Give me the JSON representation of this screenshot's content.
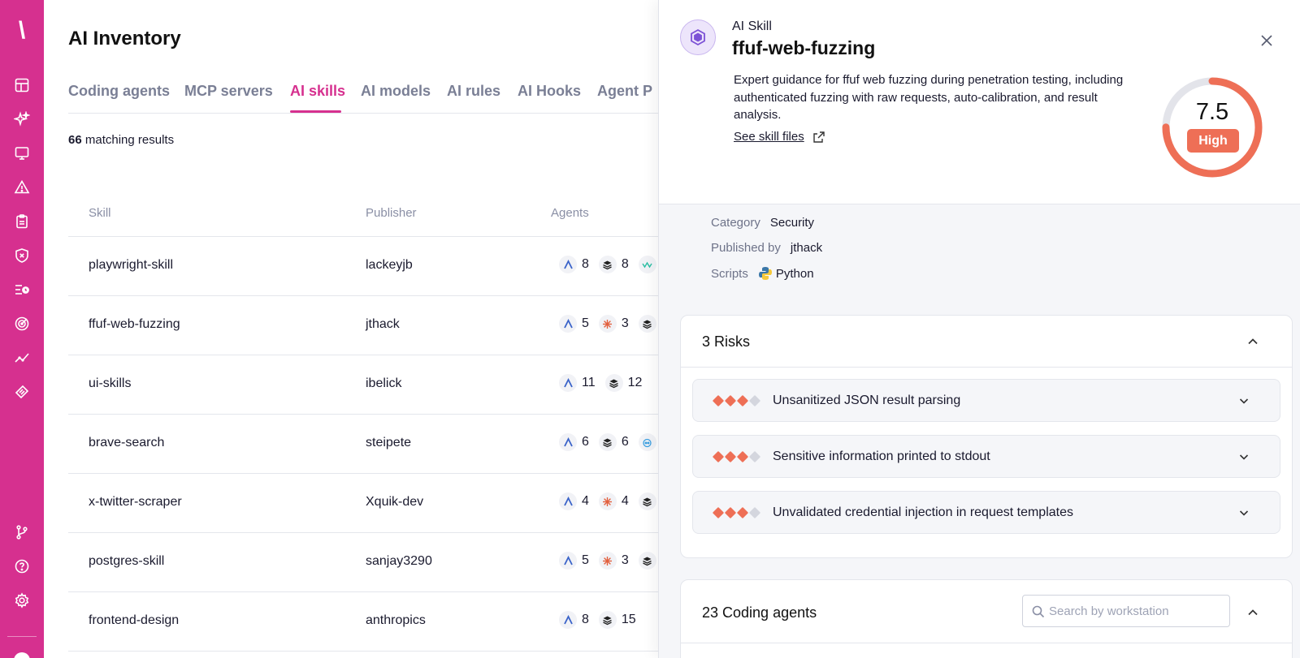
{
  "sidebar": {
    "logo_glyph": "\\",
    "items": [
      {
        "name": "dashboard-icon"
      },
      {
        "name": "sparkles-icon"
      },
      {
        "name": "monitor-icon"
      },
      {
        "name": "alert-triangle-icon"
      },
      {
        "name": "clipboard-icon"
      },
      {
        "name": "shield-x-icon"
      },
      {
        "name": "list-clock-icon"
      },
      {
        "name": "radar-icon"
      },
      {
        "name": "trend-chart-icon"
      },
      {
        "name": "ticket-icon"
      }
    ],
    "bottom_items": [
      {
        "name": "git-branch-icon"
      },
      {
        "name": "help-icon"
      },
      {
        "name": "settings-icon"
      }
    ],
    "color": "#d6308f"
  },
  "main": {
    "title": "AI Inventory",
    "tabs": [
      {
        "label": "Coding agents"
      },
      {
        "label": "MCP servers"
      },
      {
        "label": "AI skills",
        "active": true
      },
      {
        "label": "AI models"
      },
      {
        "label": "AI rules"
      },
      {
        "label": "AI Hooks"
      },
      {
        "label": "Agent P"
      }
    ],
    "results_count": "66",
    "results_label": " matching results",
    "columns": {
      "skill": "Skill",
      "publisher": "Publisher",
      "agents": "Agents"
    },
    "rows": [
      {
        "skill": "playwright-skill",
        "publisher": "lackeyjb",
        "agents": [
          {
            "icon": "cursor-agent-icon",
            "count": "8"
          },
          {
            "icon": "stack-agent-icon",
            "count": "8"
          },
          {
            "icon": "wave-agent-icon",
            "count": ""
          }
        ]
      },
      {
        "skill": "ffuf-web-fuzzing",
        "publisher": "jthack",
        "agents": [
          {
            "icon": "cursor-agent-icon",
            "count": "5"
          },
          {
            "icon": "claude-agent-icon",
            "count": "3"
          },
          {
            "icon": "stack-agent-icon",
            "count": ""
          }
        ]
      },
      {
        "skill": "ui-skills",
        "publisher": "ibelick",
        "agents": [
          {
            "icon": "cursor-agent-icon",
            "count": "11"
          },
          {
            "icon": "stack-agent-icon",
            "count": "12"
          }
        ]
      },
      {
        "skill": "brave-search",
        "publisher": "steipete",
        "agents": [
          {
            "icon": "cursor-agent-icon",
            "count": "6"
          },
          {
            "icon": "stack-agent-icon",
            "count": "6"
          },
          {
            "icon": "copilot-agent-icon",
            "count": ""
          }
        ]
      },
      {
        "skill": "x-twitter-scraper",
        "publisher": "Xquik-dev",
        "agents": [
          {
            "icon": "cursor-agent-icon",
            "count": "4"
          },
          {
            "icon": "claude-agent-icon",
            "count": "4"
          },
          {
            "icon": "stack-agent-icon",
            "count": ""
          }
        ]
      },
      {
        "skill": "postgres-skill",
        "publisher": "sanjay3290",
        "agents": [
          {
            "icon": "cursor-agent-icon",
            "count": "5"
          },
          {
            "icon": "claude-agent-icon",
            "count": "3"
          },
          {
            "icon": "stack-agent-icon",
            "count": ""
          }
        ]
      },
      {
        "skill": "frontend-design",
        "publisher": "anthropics",
        "agents": [
          {
            "icon": "cursor-agent-icon",
            "count": "8"
          },
          {
            "icon": "stack-agent-icon",
            "count": "15"
          }
        ]
      }
    ]
  },
  "panel": {
    "type_label": "AI Skill",
    "title": "ffuf-web-fuzzing",
    "description": "Expert guidance for ffuf web fuzzing during penetration testing, including authenticated fuzzing with raw requests, auto-calibration, and result analysis.",
    "see_files": "See skill files",
    "score": "7.5",
    "score_fraction": 0.75,
    "severity": "High",
    "accent": "#ee6f56",
    "category_label": "Category",
    "category": "Security",
    "published_label": "Published by",
    "publisher": "jthack",
    "scripts_label": "Scripts",
    "script_lang": "Python",
    "risks_title": "3 Risks",
    "risks": [
      {
        "label": "Unsanitized JSON result parsing",
        "level": 3
      },
      {
        "label": "Sensitive information printed to stdout",
        "level": 3
      },
      {
        "label": "Unvalidated credential injection in request templates",
        "level": 3
      }
    ],
    "agents_title": "23 Coding agents",
    "search_placeholder": "Search by workstation"
  }
}
